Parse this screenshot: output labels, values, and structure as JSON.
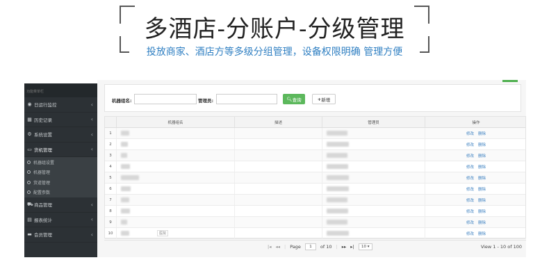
{
  "banner": {
    "title": "多酒店-分账户-分级管理",
    "subtitle": "投放商家、酒店方等多级分组管理，设备权限明确 管理方便"
  },
  "sidebar": {
    "top_label": "功能菜单栏",
    "items": [
      {
        "label": "日运行监控",
        "icon": "eye-icon"
      },
      {
        "label": "历史记录",
        "icon": "calendar-icon"
      },
      {
        "label": "系统设置",
        "icon": "gear-icon"
      },
      {
        "label": "货机管理",
        "icon": "monitor-icon"
      }
    ],
    "subitems": [
      "机器组设置",
      "机器管理",
      "货道管理",
      "配置参数"
    ],
    "items_after": [
      {
        "label": "商品管理",
        "icon": "cart-icon"
      },
      {
        "label": "报表统计",
        "icon": "chart-icon"
      },
      {
        "label": "会员管理",
        "icon": "card-icon"
      }
    ]
  },
  "search": {
    "group_label": "机器组名:",
    "manager_label": "管理员:",
    "query_button": "查询",
    "add_button": "新增"
  },
  "grid": {
    "columns": [
      "机器组名",
      "描述",
      "管理员",
      "操作"
    ],
    "rows": [
      "1",
      "2",
      "3",
      "4",
      "5",
      "6",
      "7",
      "8",
      "9",
      "10"
    ],
    "edit_label": "修改",
    "delete_label": "删除",
    "row10_note": "医院"
  },
  "pager": {
    "page_label": "Page",
    "page_value": "1",
    "of_label": "of 10",
    "page_size": "10",
    "view_text": "View 1 - 10 of 100"
  },
  "colors": {
    "accent_green": "#5cb85c",
    "link_blue": "#3a7fc0",
    "subtitle_blue": "#2f7fc2",
    "sidebar_bg": "#2c3135"
  }
}
